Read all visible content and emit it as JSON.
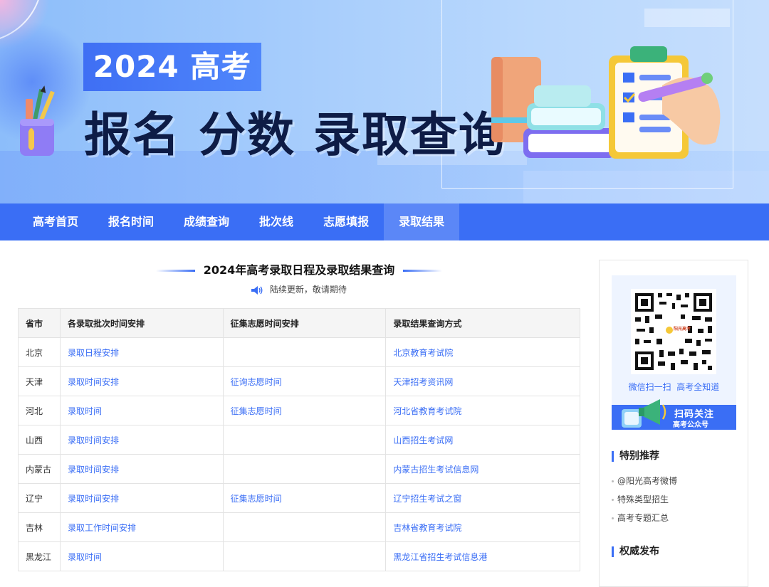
{
  "banner": {
    "year_badge": "2024 高考",
    "headline": "报名 分数 录取查询"
  },
  "nav": {
    "items": [
      {
        "label": "高考首页",
        "active": false
      },
      {
        "label": "报名时间",
        "active": false
      },
      {
        "label": "成绩查询",
        "active": false
      },
      {
        "label": "批次线",
        "active": false
      },
      {
        "label": "志愿填报",
        "active": false
      },
      {
        "label": "录取结果",
        "active": true
      }
    ]
  },
  "section": {
    "title": "2024年高考录取日程及录取结果查询",
    "note_icon": "speaker-icon",
    "note": "陆续更新，敬请期待"
  },
  "table": {
    "headers": [
      "省市",
      "各录取批次时间安排",
      "征集志愿时间安排",
      "录取结果查询方式"
    ],
    "rows": [
      [
        "北京",
        "录取日程安排",
        "",
        "北京教育考试院"
      ],
      [
        "天津",
        "录取时间安排",
        "征询志愿时间",
        "天津招考资讯网"
      ],
      [
        "河北",
        "录取时间",
        "征集志愿时间",
        "河北省教育考试院"
      ],
      [
        "山西",
        "录取时间安排",
        "",
        "山西招生考试网"
      ],
      [
        "内蒙古",
        "录取时间安排",
        "",
        "内蒙古招生考试信息网"
      ],
      [
        "辽宁",
        "录取时间安排",
        "征集志愿时间",
        "辽宁招生考试之窗"
      ],
      [
        "吉林",
        "录取工作时间安排",
        "",
        "吉林省教育考试院"
      ],
      [
        "黑龙江",
        "录取时间",
        "",
        "黑龙江省招生考试信息港"
      ]
    ]
  },
  "sidebar": {
    "qr_caption": "微信扫一扫  高考全知道",
    "qr_logo_text": "阳光高考",
    "qr_banner_line1": "扫码关注",
    "qr_banner_line2": "高考公众号",
    "special_title": "特别推荐",
    "special_items": [
      "@阳光高考微博",
      "特殊类型招生",
      "高考专题汇总"
    ],
    "authority_title": "权威发布"
  },
  "colors": {
    "primary": "#3a6ef5",
    "nav_active": "#5b87f7",
    "headline": "#0e1c46"
  }
}
